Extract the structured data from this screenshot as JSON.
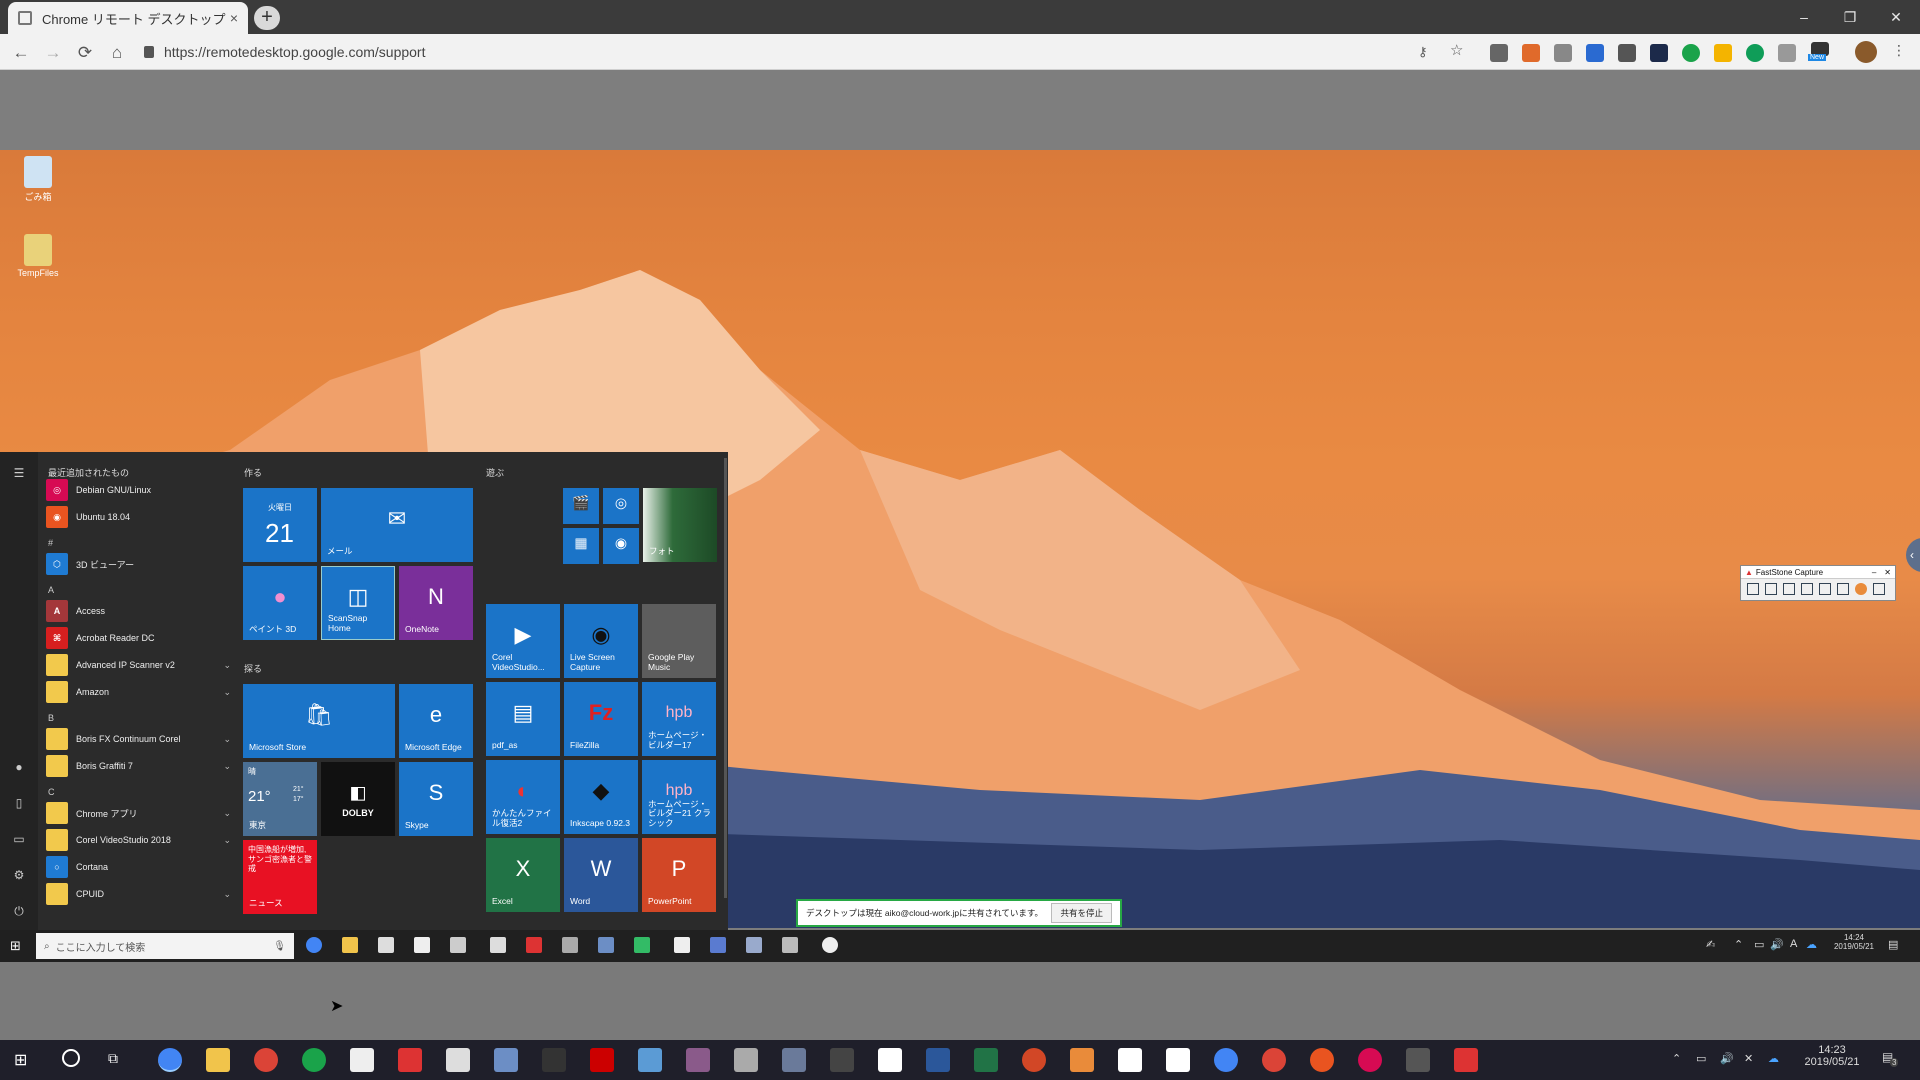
{
  "browser": {
    "tab_title": "Chrome リモート デスクトップ",
    "tab_close": "×",
    "new_tab": "+",
    "url": "https://remotedesktop.google.com/support",
    "win_minimize": "–",
    "win_restore": "❐",
    "win_close": "✕",
    "nav_back": "←",
    "nav_forward": "→",
    "nav_reload": "⟳",
    "nav_home": "⌂",
    "extension_badge": "New"
  },
  "desktop_icons": [
    {
      "label": "ごみ箱",
      "icon": "recycle-bin-icon"
    },
    {
      "label": "TempFiles",
      "icon": "folder-icon"
    }
  ],
  "start_menu": {
    "recent_header": "最近追加されたもの",
    "apps": [
      {
        "label": "Debian GNU/Linux",
        "color": "#d70a53",
        "glyph": "◎"
      },
      {
        "label": "Ubuntu 18.04",
        "color": "#e95420",
        "glyph": "◉"
      },
      {
        "letter": "#"
      },
      {
        "label": "3D ビューアー",
        "color": "#1f7bd3",
        "glyph": "⬡"
      },
      {
        "letter": "A"
      },
      {
        "label": "Access",
        "color": "#a4373a",
        "glyph": "A"
      },
      {
        "label": "Acrobat Reader DC",
        "color": "#d71f1f",
        "glyph": "⌘"
      },
      {
        "label": "Advanced IP Scanner v2",
        "color": "#f2c94c",
        "glyph": "",
        "expand": "⌄"
      },
      {
        "label": "Amazon",
        "color": "#f2c94c",
        "glyph": "",
        "expand": "⌄"
      },
      {
        "letter": "B"
      },
      {
        "label": "Boris FX Continuum Corel",
        "color": "#f2c94c",
        "glyph": "",
        "expand": "⌄"
      },
      {
        "label": "Boris Graffiti 7",
        "color": "#f2c94c",
        "glyph": "",
        "expand": "⌄"
      },
      {
        "letter": "C"
      },
      {
        "label": "Chrome アプリ",
        "color": "#f2c94c",
        "glyph": "",
        "expand": "⌄"
      },
      {
        "label": "Corel VideoStudio 2018",
        "color": "#f2c94c",
        "glyph": "",
        "expand": "⌄"
      },
      {
        "label": "Cortana",
        "color": "#1f7bd3",
        "glyph": "○"
      },
      {
        "label": "CPUID",
        "color": "#f2c94c",
        "glyph": "",
        "expand": "⌄"
      }
    ],
    "group_make": "作る",
    "group_explore": "探る",
    "group_play": "遊ぶ",
    "tiles": {
      "calendar_day": "火曜日",
      "calendar_date": "21",
      "mail": "メール",
      "paint3d": "ペイント 3D",
      "scansnap": "ScanSnap Home",
      "onenote": "OneNote",
      "store": "Microsoft Store",
      "edge": "Microsoft Edge",
      "weather_cond": "晴",
      "weather_temp": "21°",
      "weather_hi": "21°",
      "weather_lo": "17°",
      "weather_city": "東京",
      "dolby": "DOLBY",
      "skype": "Skype",
      "news_headline": "中国漁船が増加, サンゴ密漁者と警戒",
      "news": "ニュース",
      "photo_label": "フォト",
      "corel": "Corel VideoStudio...",
      "livescreen": "Live Screen Capture",
      "gplay": "Google Play Music",
      "pdfas": "pdf_as",
      "filezilla": "FileZilla",
      "homepage": "ホームページ・ビルダー17",
      "kantan": "かんたんファイル復活2",
      "inkscape": "Inkscape 0.92.3",
      "homepage_classic": "ホームページ・ビルダー21 クラシック",
      "excel": "Excel",
      "word": "Word",
      "powerpoint": "PowerPoint"
    }
  },
  "remote_taskbar": {
    "search_placeholder": "ここに入力して検索",
    "time": "14:24",
    "date": "2019/05/21",
    "ime": "A"
  },
  "share_notice": {
    "text": "デスクトップは現在 aiko@cloud-work.jpに共有されています。",
    "button": "共有を停止"
  },
  "faststone": {
    "title": "FastStone Capture"
  },
  "host_taskbar": {
    "time": "14:23",
    "date": "2019/05/21",
    "notifications": "3"
  }
}
